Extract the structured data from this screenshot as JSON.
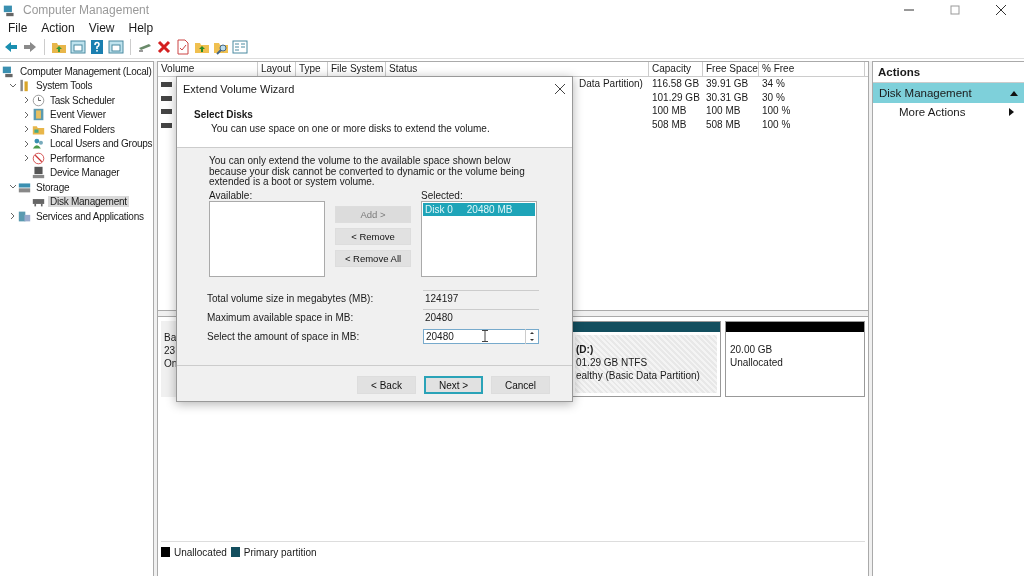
{
  "window": {
    "title": "Computer Management"
  },
  "menu": [
    "File",
    "Action",
    "View",
    "Help"
  ],
  "tree": [
    {
      "label": "Computer Management (Local)",
      "selected": false,
      "children": [
        {
          "label": "System Tools",
          "expanded": true,
          "selected": false,
          "children": [
            {
              "label": "Task Scheduler",
              "expanded": false,
              "selected": false
            },
            {
              "label": "Event Viewer",
              "expanded": false,
              "selected": false
            },
            {
              "label": "Shared Folders",
              "expanded": false,
              "selected": false
            },
            {
              "label": "Local Users and Groups",
              "expanded": false,
              "selected": false
            },
            {
              "label": "Performance",
              "expanded": false,
              "selected": false
            },
            {
              "label": "Device Manager",
              "selected": false
            }
          ]
        },
        {
          "label": "Storage",
          "expanded": true,
          "selected": false,
          "children": [
            {
              "label": "Disk Management",
              "selected": true
            }
          ]
        },
        {
          "label": "Services and Applications",
          "expanded": false,
          "selected": false
        }
      ]
    }
  ],
  "volume_list": {
    "columns": [
      "Volume",
      "Layout",
      "Type",
      "File System",
      "Status",
      "Capacity",
      "Free Space",
      "% Free"
    ],
    "rows": [
      {
        "status": "Data Partition)",
        "capacity": "116.58 GB",
        "free_space": "39.91 GB",
        "percent_free": "34 %"
      },
      {
        "capacity": "101.29 GB",
        "free_space": "30.31 GB",
        "percent_free": "30 %"
      },
      {
        "capacity": "100 MB",
        "free_space": "100 MB",
        "percent_free": "100 %"
      },
      {
        "capacity": "508 MB",
        "free_space": "508 MB",
        "percent_free": "100 %"
      }
    ]
  },
  "disk_map": {
    "disk_label_lines": [
      "Ba",
      "23",
      "On"
    ],
    "partitions": [
      {
        "kind": "primary",
        "color": "#134e5e",
        "lines": [
          "(D:)",
          "01.29 GB NTFS",
          "ealthy (Basic Data Partition)"
        ]
      },
      {
        "kind": "unallocated",
        "color": "#000000",
        "lines": [
          "20.00 GB",
          "Unallocated"
        ]
      }
    ]
  },
  "legend": [
    {
      "label": "Unallocated",
      "color": "#000000"
    },
    {
      "label": "Primary partition",
      "color": "#134e5e"
    }
  ],
  "actions": {
    "header": "Actions",
    "items": [
      {
        "kind": "section",
        "label": "Disk Management",
        "expanded": true
      },
      {
        "kind": "item",
        "label": "More Actions"
      }
    ]
  },
  "dialog": {
    "title": "Extend Volume Wizard",
    "heading": "Select Disks",
    "subheading": "You can use space on one or more disks to extend the volume.",
    "note": "You can only extend the volume to the available space shown below because your disk cannot be converted to dynamic or the volume being extended is a boot or system volume.",
    "available_label": "Available:",
    "selected_label": "Selected:",
    "selected_items": [
      {
        "disk": "Disk 0",
        "size": "20480 MB",
        "selected": true
      }
    ],
    "middle_buttons": [
      {
        "label": "Add >",
        "disabled": true
      },
      {
        "label": "< Remove",
        "disabled": false
      },
      {
        "label": "< Remove All",
        "disabled": false
      }
    ],
    "fields": [
      {
        "kind": "readonly",
        "label": "Total volume size in megabytes (MB):",
        "value": "124197"
      },
      {
        "kind": "readonly",
        "label": "Maximum available space in MB:",
        "value": "20480"
      },
      {
        "kind": "spin",
        "label": "Select the amount of space in MB:",
        "value": "20480"
      }
    ],
    "buttons": [
      {
        "label": "< Back",
        "default": false
      },
      {
        "label": "Next >",
        "default": true
      },
      {
        "label": "Cancel",
        "default": false
      }
    ]
  }
}
